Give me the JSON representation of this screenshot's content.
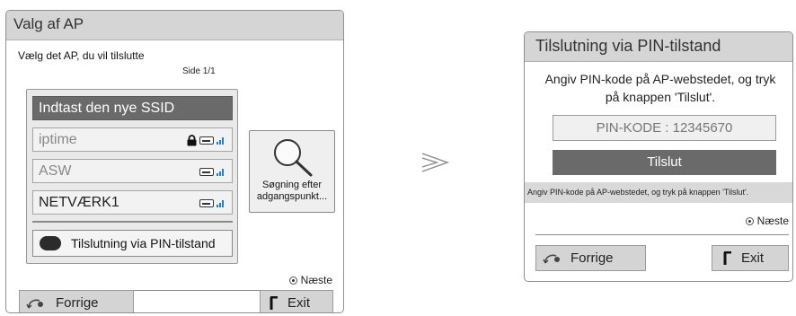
{
  "left_panel": {
    "title": "Valg af AP",
    "instruction": "Vælg det AP, du vil tilslutte",
    "page_indicator": "Side 1/1",
    "ap_list": [
      {
        "label": "Indtast den nye SSID",
        "selected": true,
        "locked": false,
        "signal": false
      },
      {
        "label": "iptime",
        "selected": false,
        "locked": true,
        "signal": true
      },
      {
        "label": "ASW",
        "selected": false,
        "locked": false,
        "signal": true
      },
      {
        "label": "NETVÆRK1",
        "selected": false,
        "locked": false,
        "signal": true
      }
    ],
    "pin_mode_button": "Tilslutning via PIN-tilstand",
    "search_button": {
      "line1": "Søgning efter",
      "line2": "adgangspunkt..."
    },
    "next_label": "Næste",
    "back_button": "Forrige",
    "exit_button": "Exit"
  },
  "right_panel": {
    "title": "Tilslutning via PIN-tilstand",
    "instruction_line1": "Angiv PIN-kode på AP-webstedet, og tryk",
    "instruction_line2": "på knappen 'Tilslut'.",
    "pin_field": "PIN-KODE : 12345670",
    "connect_button": "Tilslut",
    "hint": "Angiv PIN-kode på AP-webstedet, og tryk på knappen 'Tilslut'.",
    "next_label": "Næste",
    "back_button": "Forrige",
    "exit_button": "Exit"
  },
  "icons": {
    "lock": "lock-icon",
    "signal": "wifi-signal-icon",
    "search": "magnifier-icon",
    "back": "back-arrow-icon",
    "exit": "exit-icon",
    "transition": "double-chevron-right-icon"
  },
  "colors": {
    "title_bar": "#d5d5d5",
    "selected_row": "#6a6a6a",
    "signal_blue": "#1e7fd6",
    "button_gray": "#d4d4d4"
  }
}
